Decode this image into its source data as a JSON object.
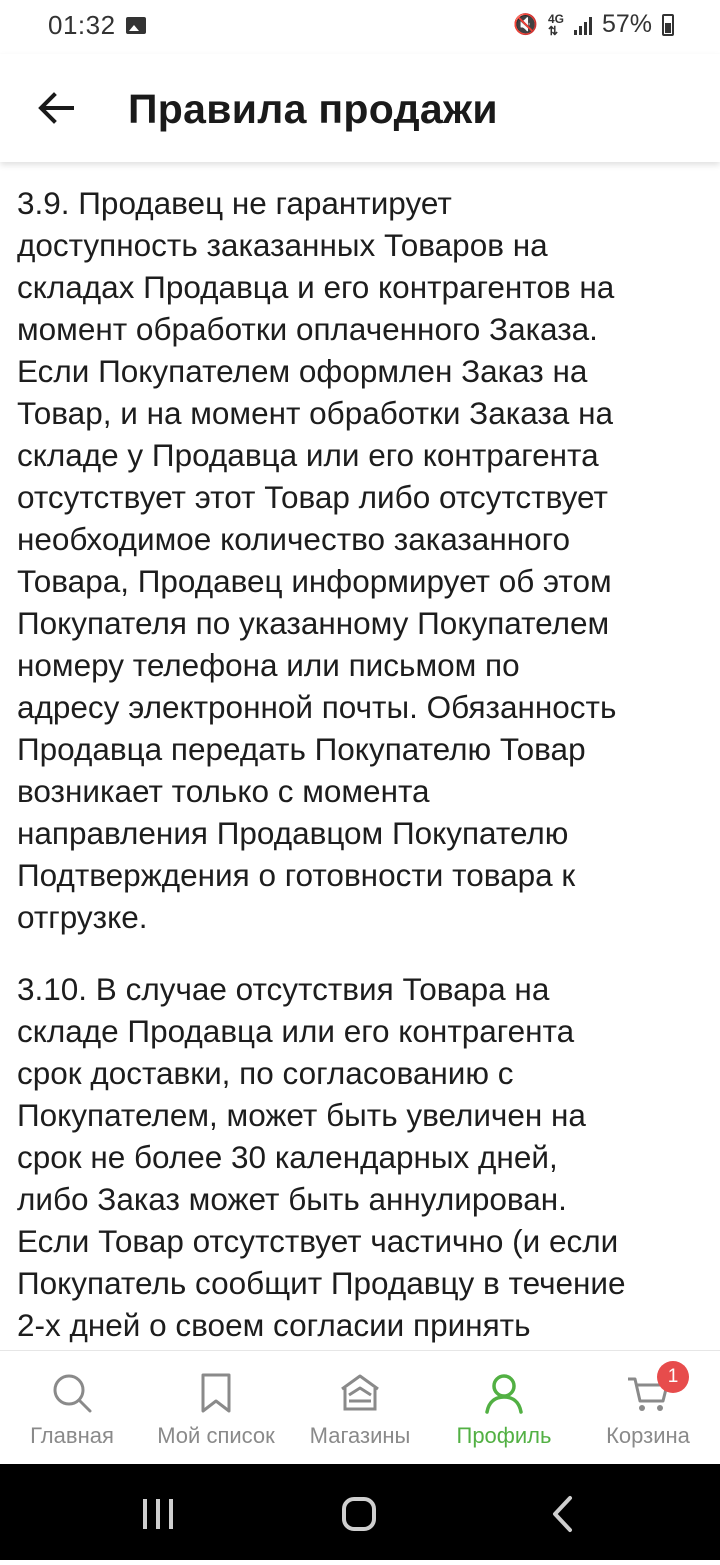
{
  "status_bar": {
    "time": "01:32",
    "battery": "57%"
  },
  "header": {
    "title": "Правила продажи"
  },
  "content": {
    "paragraphs": [
      "3.9. Продавец не гарантирует\nдоступность заказанных Товаров на\nскладах Продавца и его контрагентов на\nмомент обработки оплаченного Заказа.\nЕсли Покупателем оформлен Заказ на\nТовар, и на момент обработки Заказа на\nскладе у Продавца или его контрагента\nотсутствует этот Товар либо отсутствует\nнеобходимое количество заказанного\nТовара, Продавец информирует об этом\nПокупателя по указанному Покупателем\nномеру телефона или письмом по\nадресу электронной почты. Обязанность\nПродавца передать Покупателю Товар\nвозникает только с момента\nнаправления Продавцом Покупателю\nПодтверждения о готовности товара к\nотгрузке.",
      "3.10. В случае отсутствия Товара на\nскладе Продавца или его контрагента\nсрок доставки, по согласованию с\nПокупателем, может быть увеличен на\nсрок не более 30 календарных дней,\nлибо Заказ может быть аннулирован.\nЕсли Товар отсутствует частично (и если\nПокупатель сообщит Продавцу в течение\n2-х дней о своем согласии принять"
    ]
  },
  "bottom_nav": {
    "items": [
      {
        "label": "Главная",
        "icon": "search-icon"
      },
      {
        "label": "Мой список",
        "icon": "bookmark-icon"
      },
      {
        "label": "Магазины",
        "icon": "store-icon"
      },
      {
        "label": "Профиль",
        "icon": "profile-icon",
        "active": true
      },
      {
        "label": "Корзина",
        "icon": "cart-icon"
      }
    ],
    "cart_badge": "1"
  },
  "colors": {
    "accent": "#52b043",
    "inactive": "#8a8a8a",
    "badge": "#e74c4c"
  }
}
